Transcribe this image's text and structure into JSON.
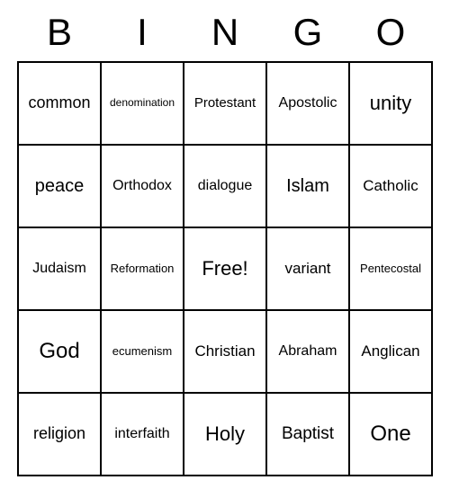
{
  "header": [
    "B",
    "I",
    "N",
    "G",
    "O"
  ],
  "grid": [
    [
      "common",
      "denomination",
      "Protestant",
      "Apostolic",
      "unity"
    ],
    [
      "peace",
      "Orthodox",
      "dialogue",
      "Islam",
      "Catholic"
    ],
    [
      "Judaism",
      "Reformation",
      "Free!",
      "variant",
      "Pentecostal"
    ],
    [
      "God",
      "ecumenism",
      "Christian",
      "Abraham",
      "Anglican"
    ],
    [
      "religion",
      "interfaith",
      "Holy",
      "Baptist",
      "One"
    ]
  ],
  "font_sizes": [
    [
      18,
      12,
      15,
      16,
      22
    ],
    [
      20,
      16,
      16,
      20,
      17
    ],
    [
      16,
      13,
      22,
      17,
      13
    ],
    [
      24,
      13,
      17,
      16,
      17
    ],
    [
      18,
      16,
      22,
      19,
      24
    ]
  ]
}
